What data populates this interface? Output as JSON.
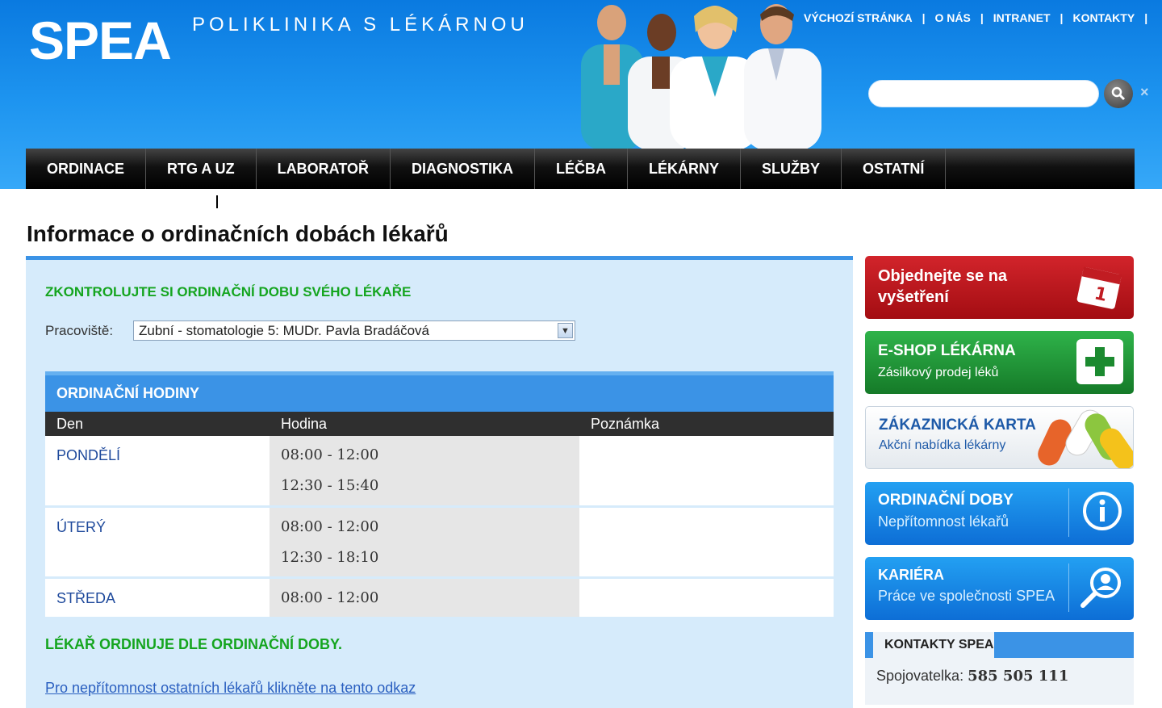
{
  "header": {
    "logo": "SPEA",
    "tagline": "POLIKLINIKA S LÉKÁRNOU",
    "top_links": [
      "VÝCHOZÍ STRÁNKA",
      "O NÁS",
      "INTRANET",
      "KONTAKTY"
    ],
    "search_placeholder": ""
  },
  "nav": [
    "ORDINACE",
    "RTG A UZ",
    "LABORATOŘ",
    "DIAGNOSTIKA",
    "LÉČBA",
    "LÉKÁRNY",
    "SLUŽBY",
    "OSTATNÍ"
  ],
  "page_title": "Informace o ordinačních dobách lékařů",
  "main": {
    "check_title": "ZKONTROLUJTE SI ORDINAČNÍ DOBU SVÉHO LÉKAŘE",
    "workplace_label": "Pracoviště:",
    "workplace_value": "Zubní - stomatologie 5: MUDr. Pavla Bradáčová",
    "hours_title": "ORDINAČNÍ HODINY",
    "columns": [
      "Den",
      "Hodina",
      "Poznámka"
    ],
    "rows": [
      {
        "day": "PONDĚLÍ",
        "hours": [
          "08:00 - 12:00",
          "12:30 - 15:40"
        ],
        "note": ""
      },
      {
        "day": "ÚTERÝ",
        "hours": [
          "08:00 - 12:00",
          "12:30 - 18:10"
        ],
        "note": ""
      },
      {
        "day": "STŘEDA",
        "hours": [
          "08:00 - 12:00"
        ],
        "note": ""
      }
    ],
    "doctor_note": "LÉKAŘ ORDINUJE DLE ORDINAČNÍ DOBY.",
    "absence_link": "Pro nepřítomnost ostatních lékařů klikněte na tento odkaz"
  },
  "sidebar": {
    "order": {
      "line1": "Objednejte se na",
      "line2": "vyšetření"
    },
    "eshop": {
      "title": "E-SHOP LÉKÁRNA",
      "sub": "Zásilkový prodej léků"
    },
    "card": {
      "title": "ZÁKAZNICKÁ KARTA",
      "sub": "Akční nabídka lékárny"
    },
    "hours": {
      "title": "ORDINAČNÍ DOBY",
      "sub": "Nepřítomnost lékařů"
    },
    "career": {
      "title": "KARIÉRA",
      "sub": "Práce ve společnosti SPEA"
    },
    "contacts": {
      "title": "KONTAKTY SPEA",
      "label": "Spojovatelka:",
      "phone": "585 505 111"
    }
  },
  "colors": {
    "brand_blue": "#1e95f0",
    "green": "#15a51f",
    "red": "#c11c22"
  }
}
